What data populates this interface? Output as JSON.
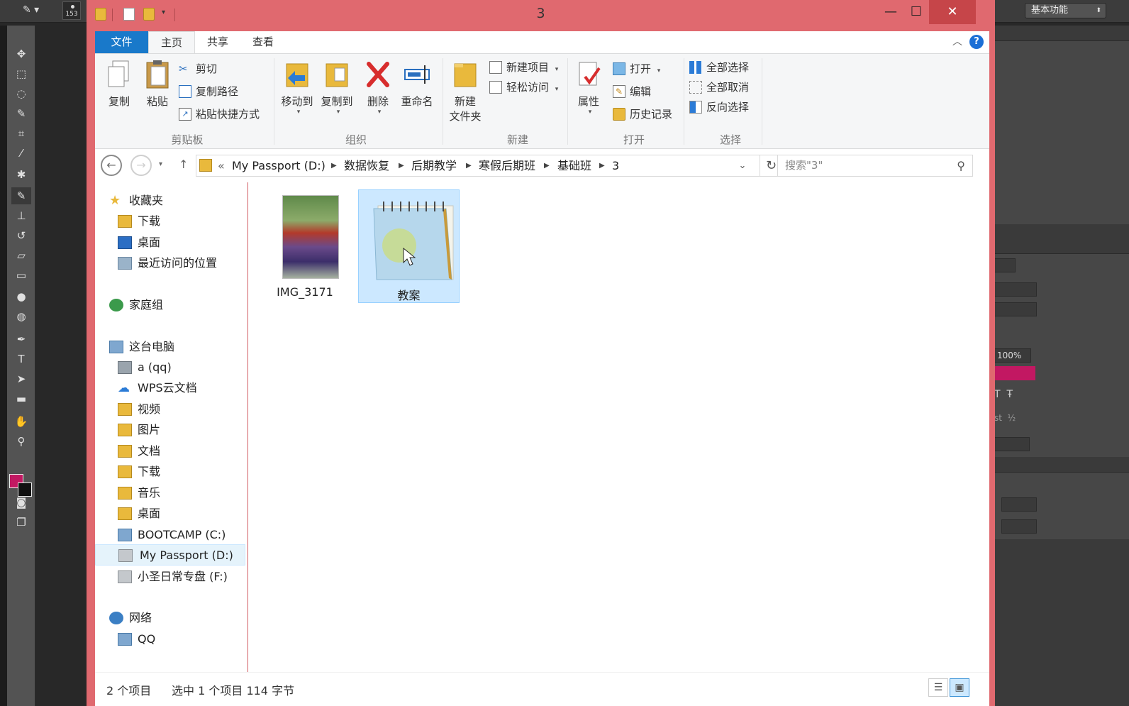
{
  "photoshop": {
    "brush_size": "153",
    "workspace": "基本功能",
    "opacity_value": "100%",
    "fg_color": "#c21862"
  },
  "window": {
    "title": "3",
    "minimize": "—",
    "maximize": "☐",
    "close": "✕"
  },
  "ribbon_tabs": [
    "文件",
    "主页",
    "共享",
    "查看"
  ],
  "ribbon": {
    "clipboard": {
      "copy": "复制",
      "paste": "粘贴",
      "cut": "剪切",
      "copy_path": "复制路径",
      "paste_shortcut": "粘贴快捷方式",
      "label": "剪贴板"
    },
    "organize": {
      "move_to": "移动到",
      "copy_to": "复制到",
      "delete": "删除",
      "rename": "重命名",
      "label": "组织"
    },
    "new": {
      "new_folder_line1": "新建",
      "new_folder_line2": "文件夹",
      "new_item": "新建项目",
      "easy_access": "轻松访问",
      "label": "新建"
    },
    "open": {
      "properties": "属性",
      "open": "打开",
      "edit": "编辑",
      "history": "历史记录",
      "label": "打开"
    },
    "select": {
      "select_all": "全部选择",
      "select_none": "全部取消",
      "invert": "反向选择",
      "label": "选择"
    }
  },
  "address": {
    "prefix": "«",
    "crumbs": [
      "My Passport (D:)",
      "数据恢复",
      "后期教学",
      "寒假后期班",
      "基础班",
      "3"
    ],
    "search_placeholder": "搜索\"3\""
  },
  "nav": {
    "favorites": "收藏夹",
    "downloads": "下载",
    "desktop": "桌面",
    "recent": "最近访问的位置",
    "homegroup": "家庭组",
    "this_pc": "这台电脑",
    "a_qq": "a (qq)",
    "wps": "WPS云文档",
    "videos": "视频",
    "pictures": "图片",
    "documents": "文档",
    "downloads2": "下载",
    "music": "音乐",
    "desktop2": "桌面",
    "bootcamp": "BOOTCAMP (C:)",
    "passport": "My Passport (D:)",
    "f_drive": "小圣日常专盘 (F:)",
    "network": "网络",
    "qq": "QQ"
  },
  "files": [
    {
      "name": "IMG_3171",
      "type": "image"
    },
    {
      "name": "教案",
      "type": "text"
    }
  ],
  "status": {
    "count": "2 个项目",
    "selected": "选中 1 个项目  114 字节"
  },
  "colors": {
    "titlebar": "#e0696f",
    "accent": "#1979ca",
    "selection": "#cce8ff"
  }
}
